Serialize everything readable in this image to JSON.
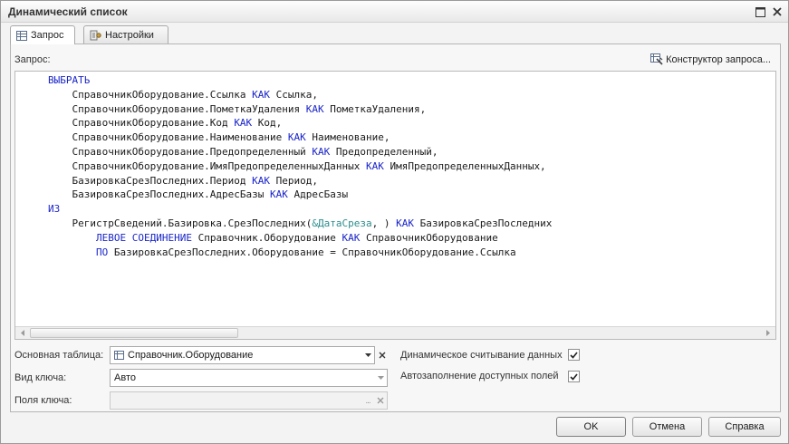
{
  "window": {
    "title": "Динамический список"
  },
  "tabs": [
    {
      "label": "Запрос",
      "icon": "table-icon",
      "active": true
    },
    {
      "label": "Настройки",
      "icon": "settings-icon",
      "active": false
    }
  ],
  "query": {
    "label": "Запрос:",
    "constructor_label": "Конструктор запроса...",
    "lines": [
      [
        {
          "t": "ВЫБРАТЬ",
          "c": "kw"
        }
      ],
      [
        {
          "t": "    СправочникОборудование.Ссылка "
        },
        {
          "t": "КАК",
          "c": "kw"
        },
        {
          "t": " Ссылка,"
        }
      ],
      [
        {
          "t": "    СправочникОборудование.ПометкаУдаления "
        },
        {
          "t": "КАК",
          "c": "kw"
        },
        {
          "t": " ПометкаУдаления,"
        }
      ],
      [
        {
          "t": "    СправочникОборудование.Код "
        },
        {
          "t": "КАК",
          "c": "kw"
        },
        {
          "t": " Код,"
        }
      ],
      [
        {
          "t": "    СправочникОборудование.Наименование "
        },
        {
          "t": "КАК",
          "c": "kw"
        },
        {
          "t": " Наименование,"
        }
      ],
      [
        {
          "t": "    СправочникОборудование.Предопределенный "
        },
        {
          "t": "КАК",
          "c": "kw"
        },
        {
          "t": " Предопределенный,"
        }
      ],
      [
        {
          "t": "    СправочникОборудование.ИмяПредопределенныхДанных "
        },
        {
          "t": "КАК",
          "c": "kw"
        },
        {
          "t": " ИмяПредопределенныхДанных,"
        }
      ],
      [
        {
          "t": "    БазировкаСрезПоследних.Период "
        },
        {
          "t": "КАК",
          "c": "kw"
        },
        {
          "t": " Период,"
        }
      ],
      [
        {
          "t": "    БазировкаСрезПоследних.АдресБазы "
        },
        {
          "t": "КАК",
          "c": "kw"
        },
        {
          "t": " АдресБазы"
        }
      ],
      [
        {
          "t": "ИЗ",
          "c": "kw"
        }
      ],
      [
        {
          "t": "    РегистрСведений.Базировка.СрезПоследних("
        },
        {
          "t": "&ДатаСреза",
          "c": "param"
        },
        {
          "t": ", ) "
        },
        {
          "t": "КАК",
          "c": "kw"
        },
        {
          "t": " БазировкаСрезПоследних"
        }
      ],
      [
        {
          "t": "        "
        },
        {
          "t": "ЛЕВОЕ СОЕДИНЕНИЕ",
          "c": "kw"
        },
        {
          "t": " Справочник.Оборудование "
        },
        {
          "t": "КАК",
          "c": "kw"
        },
        {
          "t": " СправочникОборудование"
        }
      ],
      [
        {
          "t": "        "
        },
        {
          "t": "ПО",
          "c": "kw"
        },
        {
          "t": " БазировкаСрезПоследних.Оборудование = СправочникОборудование.Ссылка"
        }
      ]
    ]
  },
  "fields": {
    "main_table": {
      "label": "Основная таблица:",
      "value": "Справочник.Оборудование"
    },
    "key_type": {
      "label": "Вид ключа:",
      "value": "Авто"
    },
    "key_fields": {
      "label": "Поля ключа:",
      "value": ""
    }
  },
  "options": {
    "dynamic_read": {
      "label": "Динамическое считывание данных",
      "checked": true
    },
    "autofill": {
      "label": "Автозаполнение доступных полей",
      "checked": true
    }
  },
  "buttons": {
    "ok": "OK",
    "cancel": "Отмена",
    "help": "Справка"
  },
  "colors": {
    "keyword": "#1b26c9",
    "parameter": "#2b8d8d"
  }
}
